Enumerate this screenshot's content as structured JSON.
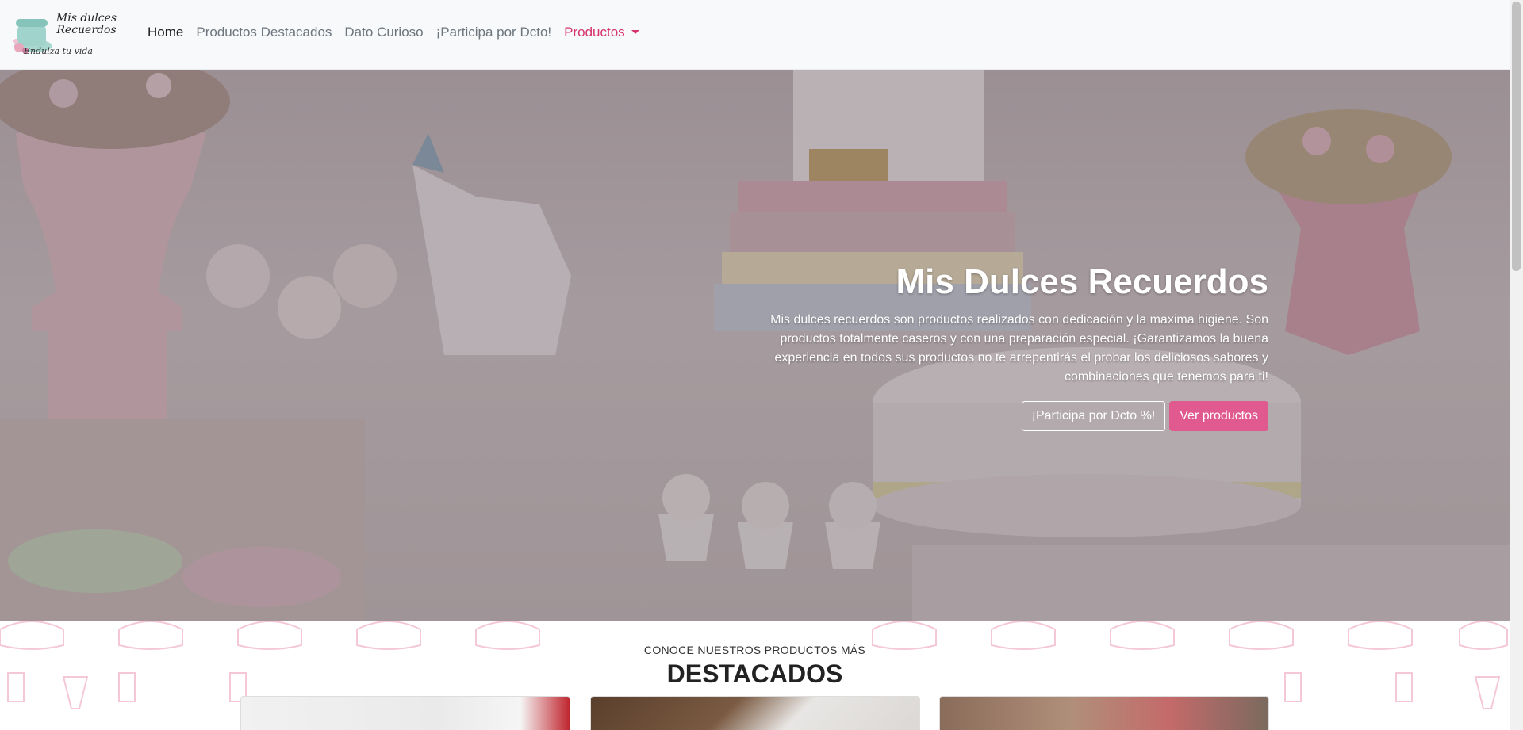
{
  "logo": {
    "name": "Mis dulces Recuerdos",
    "tagline": "Endulza tu vida"
  },
  "nav": {
    "items": [
      {
        "label": "Home"
      },
      {
        "label": "Productos Destacados"
      },
      {
        "label": "Dato Curioso"
      },
      {
        "label": "¡Participa por Dcto!"
      },
      {
        "label": "Productos"
      }
    ]
  },
  "hero": {
    "title": "Mis Dulces Recuerdos",
    "description": "Mis dulces recuerdos son productos realizados con dedicación y la maxima higiene. Son productos totalmente caseros y con una preparación especial. ¡Garantizamos la buena experiencia en todos sus productos no te arrepentirás el probar los deliciosos sabores y combinaciones que tenemos para ti!",
    "btn_discount": "¡Participa por Dcto %!",
    "btn_products": "Ver productos"
  },
  "featured": {
    "subtitle": "CONOCE NUESTROS PRODUCTOS MÁS",
    "title": "DESTACADOS"
  },
  "colors": {
    "accent": "#d6336c",
    "button": "#e05a8f",
    "navbar_bg": "#f8f9fa"
  }
}
